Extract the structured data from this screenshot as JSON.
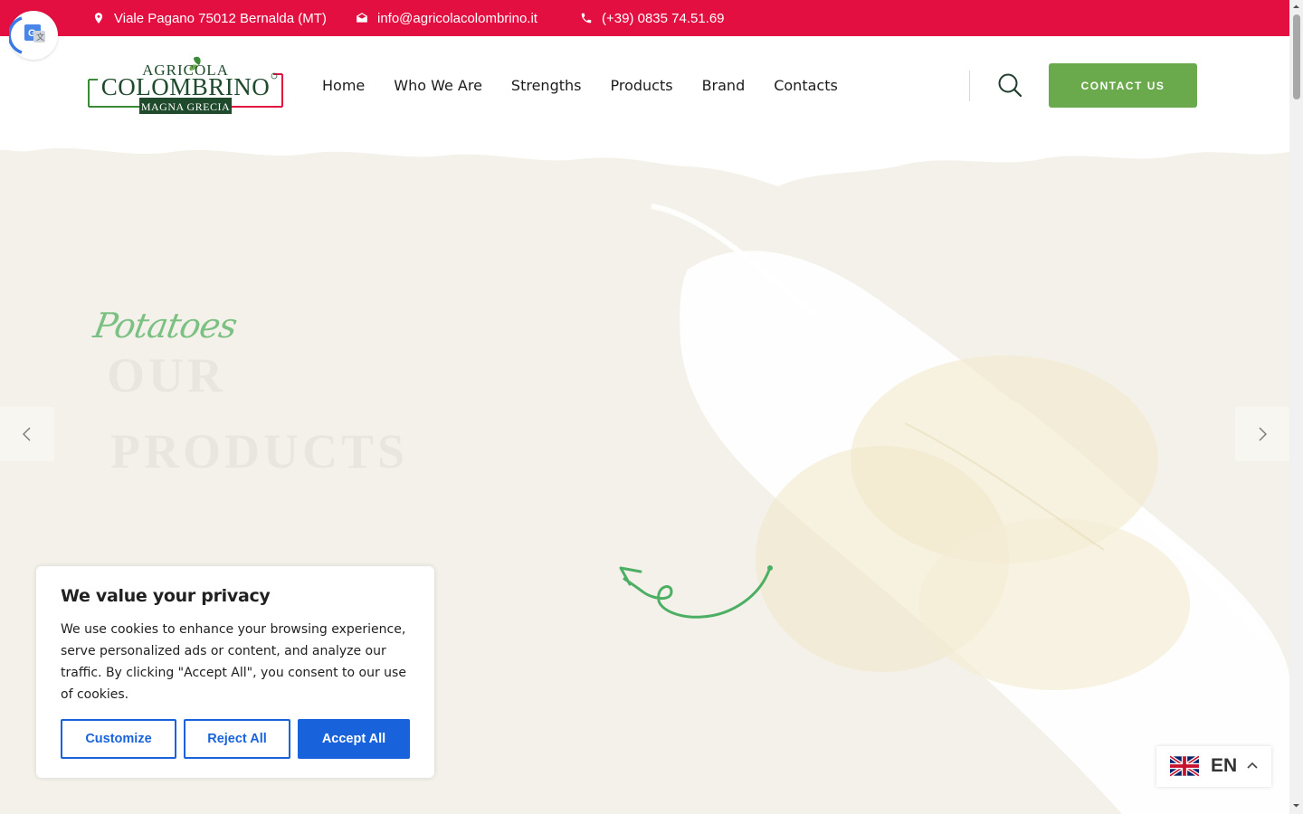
{
  "topbar": {
    "address": "Viale Pagano 75012 Bernalda (MT)",
    "email": "info@agricolacolombrino.it",
    "phone": "(+39) 0835 74.51.69"
  },
  "logo": {
    "line1": "AGRICOLA",
    "line2": "COLOMBRINO",
    "line3": "MAGNA GRECIA"
  },
  "nav": {
    "items": [
      "Home",
      "Who We Are",
      "Strengths",
      "Products",
      "Brand",
      "Contacts"
    ]
  },
  "header": {
    "contact_label": "CONTACT US"
  },
  "hero": {
    "script_title": "Potatoes",
    "line1": "OUR",
    "line2": "PRODUCTS"
  },
  "cookie": {
    "title": "We value your privacy",
    "body": "We use cookies to enhance your browsing experience, serve personalized ads or content, and analyze our traffic. By clicking \"Accept All\", you consent to our use of cookies.",
    "customize": "Customize",
    "reject": "Reject All",
    "accept": "Accept All"
  },
  "language": {
    "code": "EN",
    "flag_icon": "uk-flag-icon"
  },
  "colors": {
    "topbar": "#e40f41",
    "accent_green": "#6aaa4d",
    "cookie_blue": "#1863dc"
  }
}
